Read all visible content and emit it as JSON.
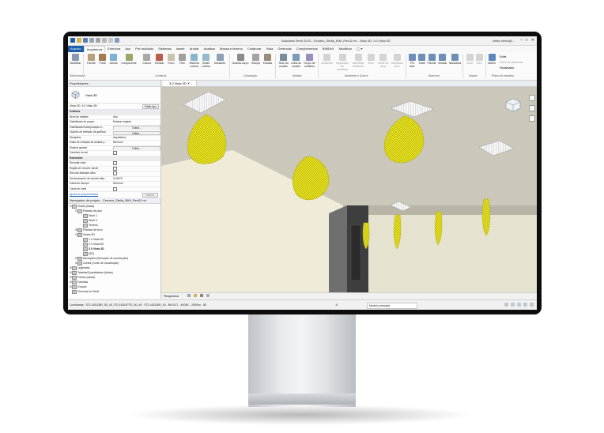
{
  "colors": {
    "accent": "#1b5faa",
    "selection_yellow": "#f2ec1a",
    "ceiling": "#c9c5b8",
    "wall": "#ece8d6"
  },
  "window": {
    "title": "Autodesk Revit 2023 - Cenario_Stella_BIM_Rev02.rvt - Vista 3D: 3.0 Vista 3D",
    "user": "lattex.vieira@...",
    "controls": [
      "–",
      "□",
      "✕"
    ]
  },
  "ribbon": {
    "tabs": [
      "Arquivo",
      "Arquitetura",
      "Estrutura",
      "Aço",
      "Pré-moldado",
      "Sistemas",
      "Inserir",
      "Anotar",
      "Analisar",
      "Massa e terreno",
      "Colaborar",
      "Vista",
      "Gerenciar",
      "Complementos",
      "BIMDeX",
      "Modificar",
      "◯ ▾"
    ],
    "active_tab": "Arquitetura",
    "buttons": [
      "Modificar",
      "Parede",
      "Porta",
      "Janela",
      "Componente",
      "Coluna",
      "Telhado",
      "Forro",
      "Piso",
      "Sistema cortina",
      "Grade cortina",
      "Montante",
      "Guarda-corpo",
      "Rampa",
      "Escada",
      "Texto do modelo",
      "Linha do modelo",
      "Grupo de modelos",
      "Ambiente",
      "Separador de ambiente",
      "Identificar ambiente",
      "Área",
      "Limite de área",
      "Identificar área",
      "Por face",
      "Shaft",
      "Parede",
      "Vertical",
      "Mansarda",
      "Nível",
      "Eixo",
      "Definir",
      "Exibir",
      "Plano de referência",
      "Visualizador"
    ],
    "groups": [
      "Selecionar ▾",
      "Construir",
      "Circulação",
      "Modelo",
      "Ambiente e Área ▾",
      "Abertura",
      "Dados",
      "Plano de trabalho"
    ]
  },
  "properties": {
    "header": "Propriedades",
    "type_name": "Vista 3D",
    "view_selector": "Vista 3D: 3.0 Vista 3D",
    "edit_type": "Editar tipo",
    "rows": [
      {
        "k": "Gráficos",
        "v": "",
        "cat": true
      },
      {
        "k": "Nível de detalhe",
        "v": "Alto"
      },
      {
        "k": "Visibilidade de peças",
        "v": "Mostrar original"
      },
      {
        "k": "Visibilidade/Sobreposição d...",
        "btn": "Editar..."
      },
      {
        "k": "Opções de exibição de gráficos",
        "btn": "Editar..."
      },
      {
        "k": "Disciplina",
        "v": "Arquitetura"
      },
      {
        "k": "Estilo de exibição de análise p...",
        "v": "Nenhum"
      },
      {
        "k": "Mostrar grades",
        "btn": "Editar..."
      },
      {
        "k": "Caminho do sol",
        "chk": true
      },
      {
        "k": "Extensões",
        "v": "",
        "cat": true
      },
      {
        "k": "Recortar vista",
        "chk": true
      },
      {
        "k": "Região de recorte visível",
        "chk": true
      },
      {
        "k": "Recorte afastado ativo",
        "chk": true
      },
      {
        "k": "Deslocamento de recorte afas...",
        "v": "11,6679"
      },
      {
        "k": "Caixa de escopo",
        "v": "Nenhum"
      },
      {
        "k": "Caixa de corte",
        "chk": true
      }
    ],
    "help_link": "Ajuda de propriedades",
    "apply_label": "Aplicar"
  },
  "browser": {
    "header": "Navegador de projeto - Cenario_Stella_BIM_Rev02.rvt",
    "items": [
      {
        "label": "Vistas (todas)",
        "depth": 0,
        "exp": "⊟"
      },
      {
        "label": "Plantas de piso",
        "depth": 1,
        "exp": "⊟"
      },
      {
        "label": "Nível 1",
        "depth": 2
      },
      {
        "label": "Nível 2",
        "depth": 2
      },
      {
        "label": "Terreno",
        "depth": 2
      },
      {
        "label": "Plantas de forro",
        "depth": 1,
        "exp": "⊞"
      },
      {
        "label": "Vistas 3D",
        "depth": 1,
        "exp": "⊟"
      },
      {
        "label": "1.0 Vista 3D",
        "depth": 2
      },
      {
        "label": "2.0 Vista 3D",
        "depth": 2
      },
      {
        "label": "3.0 Vista 3D",
        "depth": 2,
        "bold": true
      },
      {
        "label": "{3D}",
        "depth": 2
      },
      {
        "label": "Elevações (Elevação de construção)",
        "depth": 1,
        "exp": "⊞"
      },
      {
        "label": "Cortes (Corte de construção)",
        "depth": 1,
        "exp": "⊞"
      },
      {
        "label": "Legendas",
        "depth": 0,
        "exp": "⊞"
      },
      {
        "label": "Tabelas/Quantidades (todas)",
        "depth": 0,
        "exp": "⊞"
      },
      {
        "label": "Folhas (todas)",
        "depth": 0,
        "exp": "⊞"
      },
      {
        "label": "Famílias",
        "depth": 0,
        "exp": "⊞"
      },
      {
        "label": "Grupos",
        "depth": 0,
        "exp": "⊞"
      },
      {
        "label": "Vínculos do Revit",
        "depth": 0
      }
    ]
  },
  "view": {
    "tab_label": "3.0 Vista 3D",
    "projection": "Perspectiva"
  },
  "status": {
    "message": "Luminárias : STL14511BR_50_40_STL14511PTD_50_40 : STL14511BR_40 - BIVOLT - 4000K - 2500lm - 80",
    "zero": ":0",
    "model": "Modelo principal"
  }
}
